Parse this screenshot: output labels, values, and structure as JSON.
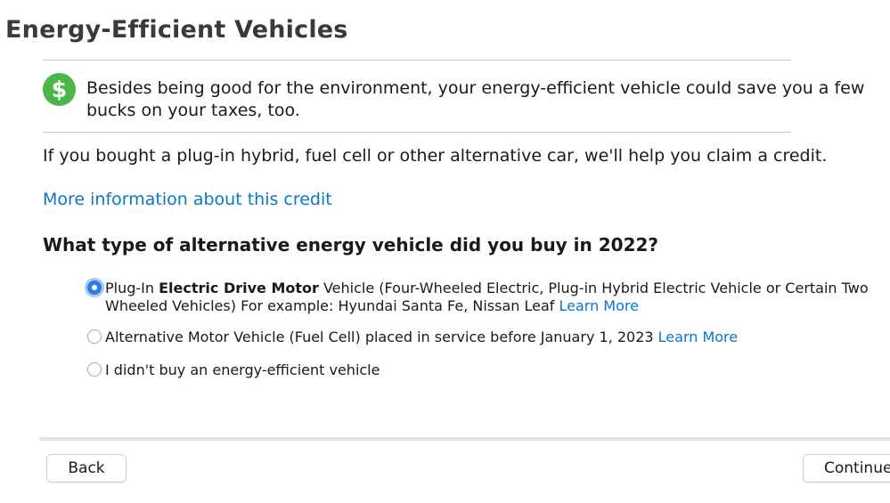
{
  "page": {
    "title": "Energy-Efficient Vehicles"
  },
  "tip": {
    "icon": "dollar-circle-icon",
    "icon_symbol": "$",
    "icon_color": "#4cb648",
    "line1": "Besides being good for the environment, your energy-efficient vehicle could save you a few",
    "line2": "bucks on your taxes, too."
  },
  "intro": "If you bought a plug-in hybrid, fuel cell or other alternative car, we'll help you claim a credit.",
  "info_link": "More information about this credit",
  "question": "What type of alternative energy vehicle did you buy in 2022?",
  "options": [
    {
      "selected": true,
      "prefix": "Plug-In ",
      "bold": "Electric Drive Motor",
      "line1_rest": " Vehicle (Four-Wheeled Electric, Plug-in Hybrid Electric Vehicle or Certain Two",
      "line2": "Wheeled Vehicles) For example: Hyundai Santa Fe, Nissan Leaf ",
      "learn_more": "Learn More"
    },
    {
      "selected": false,
      "text": "Alternative Motor Vehicle (Fuel Cell) placed in service before January 1, 2023 ",
      "learn_more": "Learn More"
    },
    {
      "selected": false,
      "text": "I didn't buy an energy-efficient vehicle"
    }
  ],
  "buttons": {
    "back": "Back",
    "continue": "Continue"
  },
  "colors": {
    "link": "#0a77c9",
    "radio_selected": "#2f7de1"
  }
}
